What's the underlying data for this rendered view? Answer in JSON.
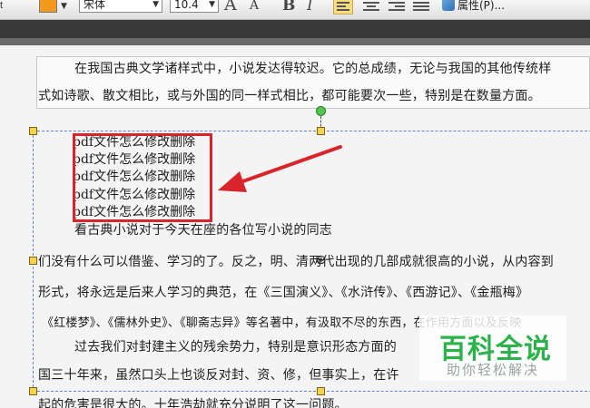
{
  "toolbar": {
    "left_stub": "t",
    "font_name": "宋体",
    "font_size": "10.4",
    "bold_label": "B",
    "italic_label": "I",
    "grow_label": "A",
    "shrink_label": "A",
    "properties_label": "属性(P)...",
    "dropdown_glyph": "▼",
    "accent_color": "#f39a1e"
  },
  "document": {
    "paragraph1": [
      "在我国古典文学诸样式中，小说发达得较迟。它的总成绩，无论与我国的其他传统样",
      "式如诗歌、散文相比，或与外国的同一样式相比，都可能要次一些，特别是在数量方面。"
    ],
    "inserted_lines": [
      "pdf文件怎么修改删除",
      "pdf文件怎么修改删除",
      "pdf文件怎么修改删除",
      "pdf文件怎么修改删除",
      "pdf文件怎么修改删除"
    ],
    "body_lines": [
      "看古典小说对于今天在座的各位写小说的同志",
      "们没有什么可以借鉴、学习的了。反之，明、清两代出现的几部成就很高的小说，从内容到",
      "形式，将永远是后来人学习的典范，在《三国演义》、《水浒传》、《西游记》、《金瓶梅》",
      "《红楼梦》、《儒林外史》、《聊斋志异》等名著中，有汲取不尽的东西，在作用方面以及反映",
      "过去我们对封建主义的残余势力，特别是意识形态方面的",
      "国三十年来，虽然口头上也谈反对封、资、修，但事实上，在许",
      "起的危害是很大的。十年浩劫就充分说明了这一问题。"
    ]
  },
  "watermark": {
    "title": "百科全说",
    "subtitle": "助你轻松解决",
    "color": "#2bb24a"
  }
}
